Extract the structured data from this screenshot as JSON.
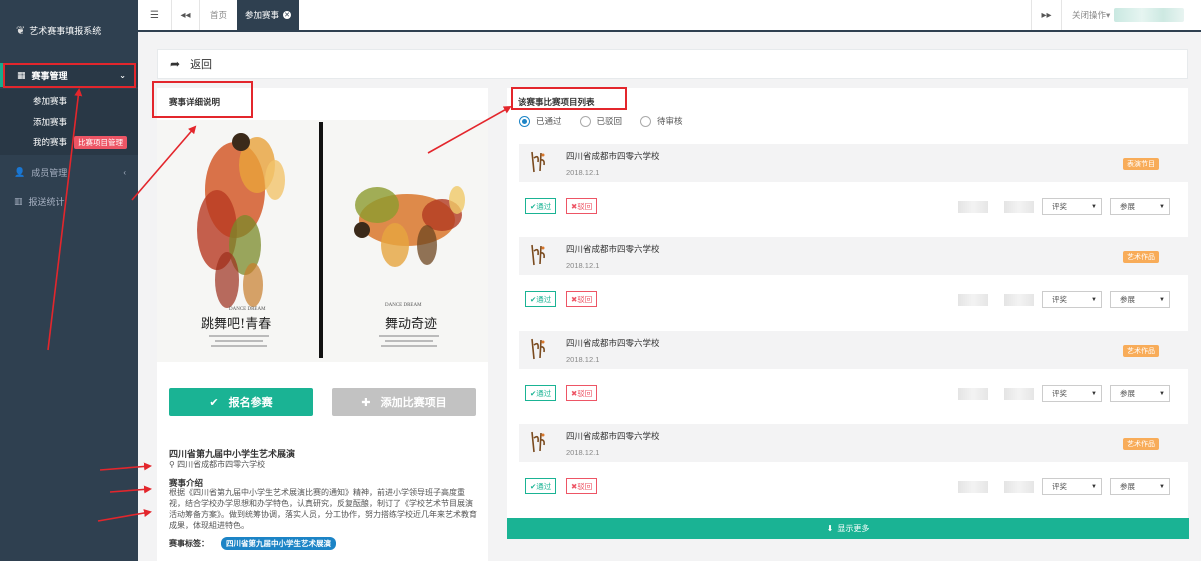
{
  "sidebar": {
    "app_title": "艺术赛事填报系统",
    "nav_active": "赛事管理",
    "sub_items": [
      "参加赛事",
      "添加赛事",
      "我的赛事"
    ],
    "sub_tag": "比赛项目管理",
    "nav_members": "成员管理",
    "nav_stats": "报送统计",
    "icons": {
      "logo": "wheat-icon",
      "grid": "grid-icon",
      "user": "user-icon",
      "chart": "bar-chart-icon"
    }
  },
  "topbar": {
    "tab_home": "首页",
    "tab_active": "参加赛事",
    "close_ops": "关闭操作"
  },
  "back": {
    "label": "返回"
  },
  "detail": {
    "title": "赛事详细说明",
    "poster_left_title": "跳舞吧!青春",
    "poster_right_title": "舞动奇迹",
    "poster_caption": "DANCE DREAM",
    "btn_signup": "报名参赛",
    "btn_add": "添加比赛项目",
    "event_name": "四川省第九届中小学生艺术展演",
    "event_location": "四川省成都市四零六学校",
    "intro_heading": "赛事介绍",
    "intro_text": "根据《四川省第九届中小学生艺术展演比赛的通知》精神，前进小学领导班子高度重视，结合学校办学思想和办学特色，认真研究，反复酝酿，制订了《学校艺术节目展演活动筹备方案》。做到统筹协调，落实人员，分工协作，努力搭练学校近几年来艺术教育成果，体现組进特色。",
    "tags_label": "赛事标签：",
    "tag": "四川省第九届中小学生艺术展演"
  },
  "projects": {
    "title": "该赛事比赛项目列表",
    "filters": [
      "已通过",
      "已驳回",
      "待审核"
    ],
    "selected_filter": "已通过",
    "approve_label": "通过",
    "reject_label": "驳回",
    "select_review": "评奖",
    "select_exhibit": "参展",
    "items": [
      {
        "school": "四川省成都市四零六学校",
        "date": "2018.12.1",
        "badge": "表演节目"
      },
      {
        "school": "四川省成都市四零六学校",
        "date": "2018.12.1",
        "badge": "艺术作品"
      },
      {
        "school": "四川省成都市四零六学校",
        "date": "2018.12.1",
        "badge": "艺术作品"
      },
      {
        "school": "四川省成都市四零六学校",
        "date": "2018.12.1",
        "badge": "艺术作品"
      }
    ],
    "show_more": "显示更多"
  },
  "colors": {
    "sidebar": "#2f4050",
    "accent": "#1ab394",
    "badge": "#f8ac59",
    "danger": "#ed5565",
    "annotation": "#e3262c"
  }
}
